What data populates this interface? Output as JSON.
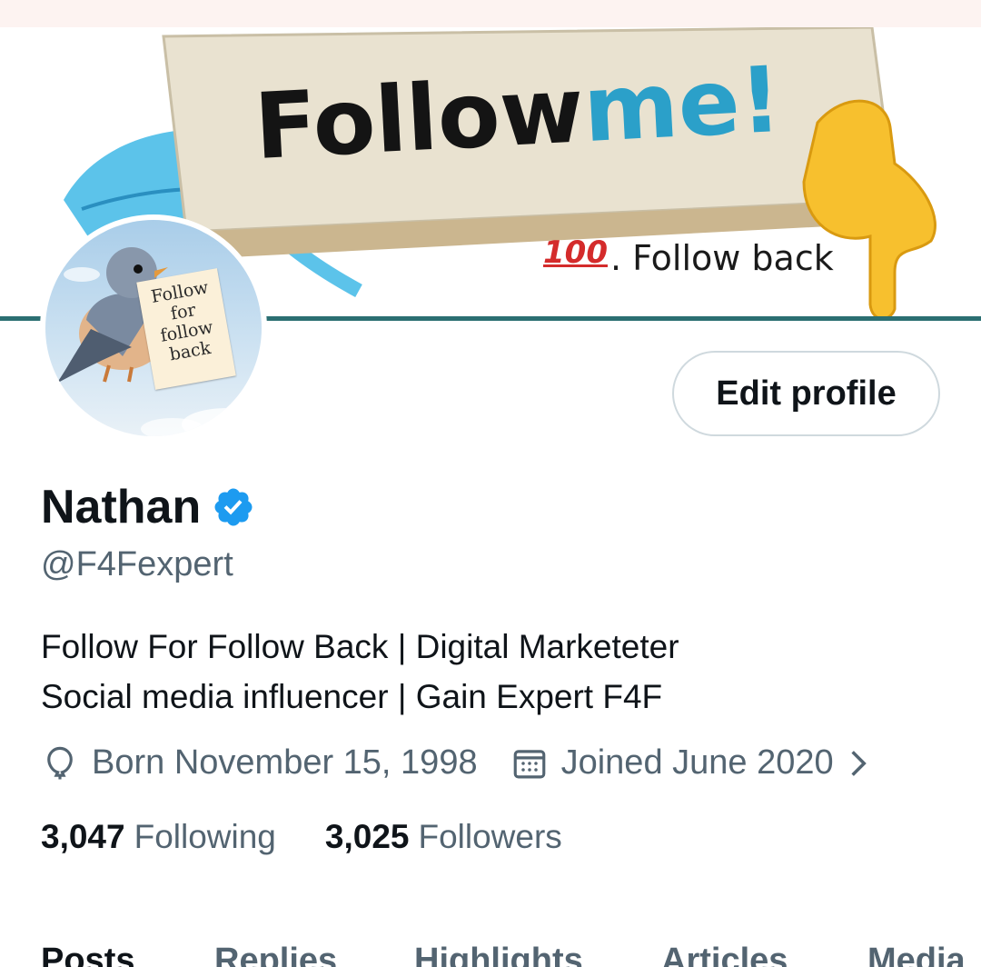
{
  "banner": {
    "headline_part1": "Follow",
    "headline_part2": "me!",
    "emoji_100": "100",
    "subtext": ". Follow back"
  },
  "avatar": {
    "note_text": [
      "Follow",
      "for",
      "follow",
      "back"
    ]
  },
  "profile": {
    "edit_button_label": "Edit profile",
    "name": "Nathan",
    "handle": "@F4Fexpert",
    "bio_lines": [
      "Follow For Follow Back | Digital Marketeter",
      "Social media influencer | Gain Expert F4F"
    ],
    "born": "Born November 15, 1998",
    "joined": "Joined June 2020",
    "following_count": "3,047",
    "following_label": "Following",
    "followers_count": "3,025",
    "followers_label": "Followers"
  },
  "tabs": [
    "Posts",
    "Replies",
    "Highlights",
    "Articles",
    "Media"
  ],
  "colors": {
    "accent": "#1d9bf0",
    "text_primary": "#0f1419",
    "text_secondary": "#536471",
    "border": "#cfd9de"
  },
  "icons": {
    "verified": "verified-badge-icon",
    "birthday": "balloon-icon",
    "calendar": "calendar-icon",
    "chevron": "chevron-right-icon"
  }
}
